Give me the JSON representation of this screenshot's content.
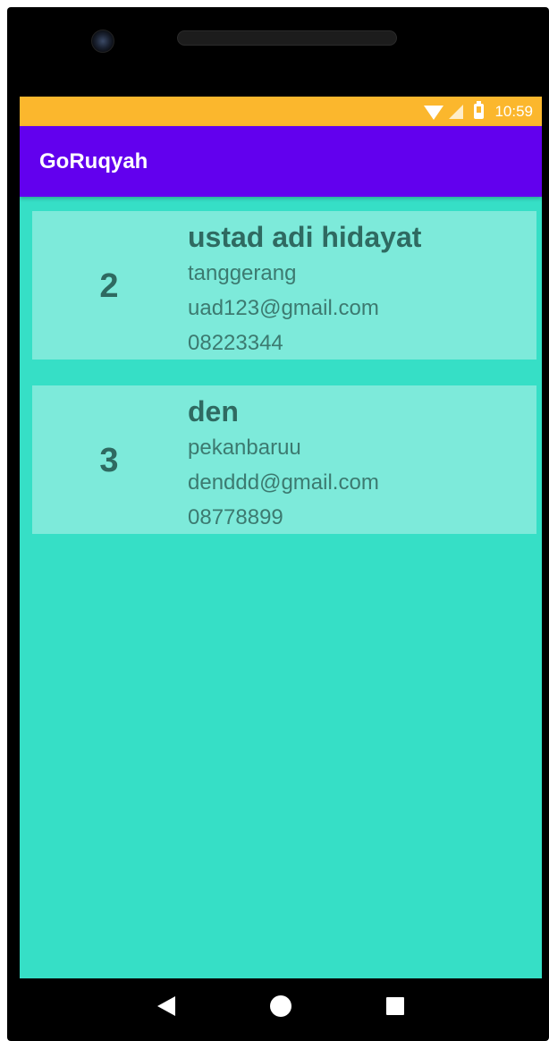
{
  "status_bar": {
    "time": "10:59",
    "icons": [
      "wifi-icon",
      "signal-icon",
      "battery-icon"
    ]
  },
  "app_bar": {
    "title": "GoRuqyah"
  },
  "list": {
    "items": [
      {
        "id": "2",
        "name": "ustad adi hidayat",
        "city": "tanggerang",
        "email": "uad123@gmail.com",
        "phone": "08223344"
      },
      {
        "id": "3",
        "name": "den",
        "city": "pekanbaruu",
        "email": "denddd@gmail.com",
        "phone": "08778899"
      }
    ]
  },
  "nav_bar": {
    "icons": [
      "back-icon",
      "home-icon",
      "recents-icon"
    ]
  },
  "colors": {
    "status_bar": "#fbb72d",
    "app_bar": "#6200ee",
    "background": "#36dfc6",
    "card": "#7deada",
    "card_text": "#2f6a61"
  }
}
